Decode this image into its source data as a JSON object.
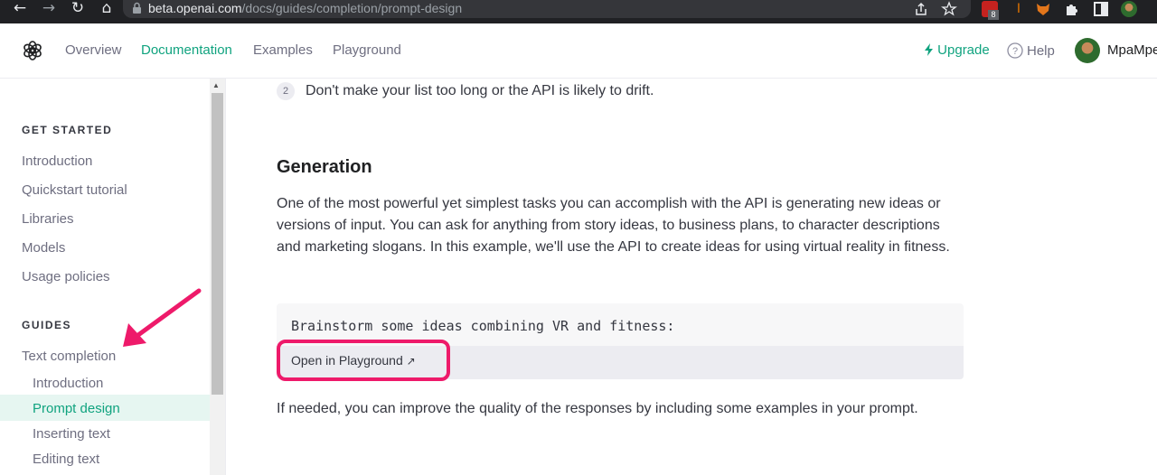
{
  "browser": {
    "url_domain": "beta.openai.com",
    "url_path": "/docs/guides/completion/prompt-design",
    "extension_badge": "8",
    "back_icon": "back-arrow-icon",
    "forward_icon": "forward-arrow-icon",
    "reload_icon": "reload-icon",
    "home_icon": "home-icon"
  },
  "topnav": {
    "links": [
      "Overview",
      "Documentation",
      "Examples",
      "Playground"
    ],
    "active_index": 1,
    "upgrade": "Upgrade",
    "help": "Help",
    "username": "MpaMpe"
  },
  "sidebar": {
    "sections": [
      {
        "heading": "GET STARTED",
        "items": [
          "Introduction",
          "Quickstart tutorial",
          "Libraries",
          "Models",
          "Usage policies"
        ]
      },
      {
        "heading": "GUIDES",
        "items": [
          "Text completion"
        ],
        "subitems": [
          "Introduction",
          "Prompt design",
          "Inserting text",
          "Editing text"
        ],
        "active_subitem": "Prompt design"
      }
    ]
  },
  "content": {
    "list_number": "2",
    "list_text": "Don't make your list too long or the API is likely to drift.",
    "heading": "Generation",
    "paragraph": "One of the most powerful yet simplest tasks you can accomplish with the API is generating new ideas or versions of input. You can ask for anything from story ideas, to business plans, to character descriptions and marketing slogans. In this example, we'll use the API to create ideas for using virtual reality in fitness.",
    "code": "Brainstorm some ideas combining VR and fitness:",
    "open_button": "Open in Playground",
    "open_button_icon": "↗",
    "paragraph2": "If needed, you can improve the quality of the responses by including some examples in your prompt."
  },
  "colors": {
    "accent": "#10a37f",
    "annotation": "#ee1a6a",
    "chrome_bg": "#202124"
  }
}
